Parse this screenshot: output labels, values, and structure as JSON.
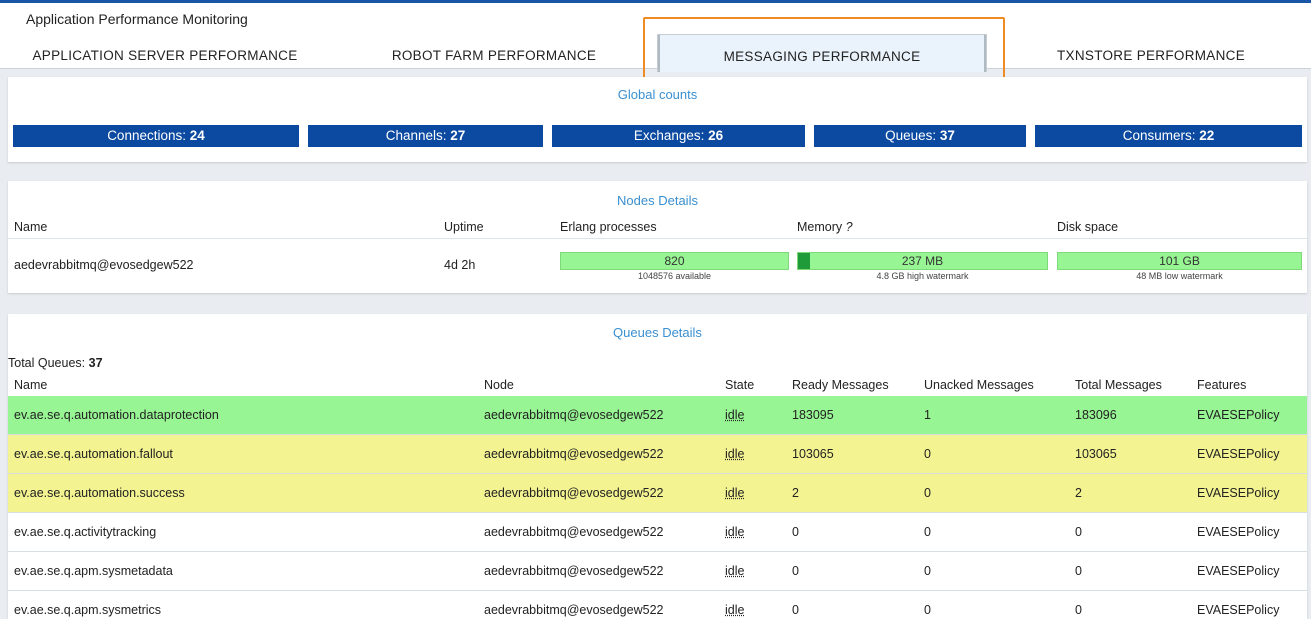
{
  "app": {
    "title": "Application Performance Monitoring"
  },
  "tabs": [
    {
      "label": "APPLICATION SERVER PERFORMANCE"
    },
    {
      "label": "ROBOT FARM PERFORMANCE"
    },
    {
      "label": "MESSAGING PERFORMANCE",
      "active": true
    },
    {
      "label": "TXNSTORE PERFORMANCE"
    }
  ],
  "global_counts": {
    "title": "Global counts",
    "items": [
      {
        "label": "Connections:",
        "value": "24"
      },
      {
        "label": "Channels:",
        "value": "27"
      },
      {
        "label": "Exchanges:",
        "value": "26"
      },
      {
        "label": "Queues:",
        "value": "37"
      },
      {
        "label": "Consumers:",
        "value": "22"
      }
    ]
  },
  "nodes": {
    "title": "Nodes Details",
    "headers": {
      "name": "Name",
      "uptime": "Uptime",
      "erlang": "Erlang processes",
      "memory": "Memory",
      "memory_help": "?",
      "disk": "Disk space"
    },
    "rows": [
      {
        "name": "aedevrabbitmq@evosedgew522",
        "uptime": "4d 2h",
        "erlang": {
          "value": "820",
          "sub": "1048576 available"
        },
        "memory": {
          "value": "237 MB",
          "sub": "4.8 GB high watermark",
          "fraction": 0.05
        },
        "disk": {
          "value": "101 GB",
          "sub": "48 MB low watermark"
        }
      }
    ]
  },
  "queues": {
    "title": "Queues Details",
    "total_label": "Total Queues:",
    "total_value": "37",
    "headers": {
      "name": "Name",
      "node": "Node",
      "state": "State",
      "ready": "Ready Messages",
      "unacked": "Unacked Messages",
      "total": "Total Messages",
      "features": "Features"
    },
    "rows": [
      {
        "name": "ev.ae.se.q.automation.dataprotection",
        "node": "aedevrabbitmq@evosedgew522",
        "state": "idle",
        "ready": "183095",
        "unacked": "1",
        "total": "183096",
        "features": "EVAESEPolicy",
        "highlight": "green"
      },
      {
        "name": "ev.ae.se.q.automation.fallout",
        "node": "aedevrabbitmq@evosedgew522",
        "state": "idle",
        "ready": "103065",
        "unacked": "0",
        "total": "103065",
        "features": "EVAESEPolicy",
        "highlight": "yellow"
      },
      {
        "name": "ev.ae.se.q.automation.success",
        "node": "aedevrabbitmq@evosedgew522",
        "state": "idle",
        "ready": "2",
        "unacked": "0",
        "total": "2",
        "features": "EVAESEPolicy",
        "highlight": "yellow"
      },
      {
        "name": "ev.ae.se.q.activitytracking",
        "node": "aedevrabbitmq@evosedgew522",
        "state": "idle",
        "ready": "0",
        "unacked": "0",
        "total": "0",
        "features": "EVAESEPolicy",
        "highlight": "none"
      },
      {
        "name": "ev.ae.se.q.apm.sysmetadata",
        "node": "aedevrabbitmq@evosedgew522",
        "state": "idle",
        "ready": "0",
        "unacked": "0",
        "total": "0",
        "features": "EVAESEPolicy",
        "highlight": "none"
      },
      {
        "name": "ev.ae.se.q.apm.sysmetrics",
        "node": "aedevrabbitmq@evosedgew522",
        "state": "idle",
        "ready": "0",
        "unacked": "0",
        "total": "0",
        "features": "EVAESEPolicy",
        "highlight": "none"
      }
    ]
  },
  "colors": {
    "accent": "#0b4aa0",
    "panel_title": "#3a8fd0",
    "highlight_box": "#f08a24",
    "green_row": "#97f593",
    "yellow_row": "#f4f391"
  }
}
